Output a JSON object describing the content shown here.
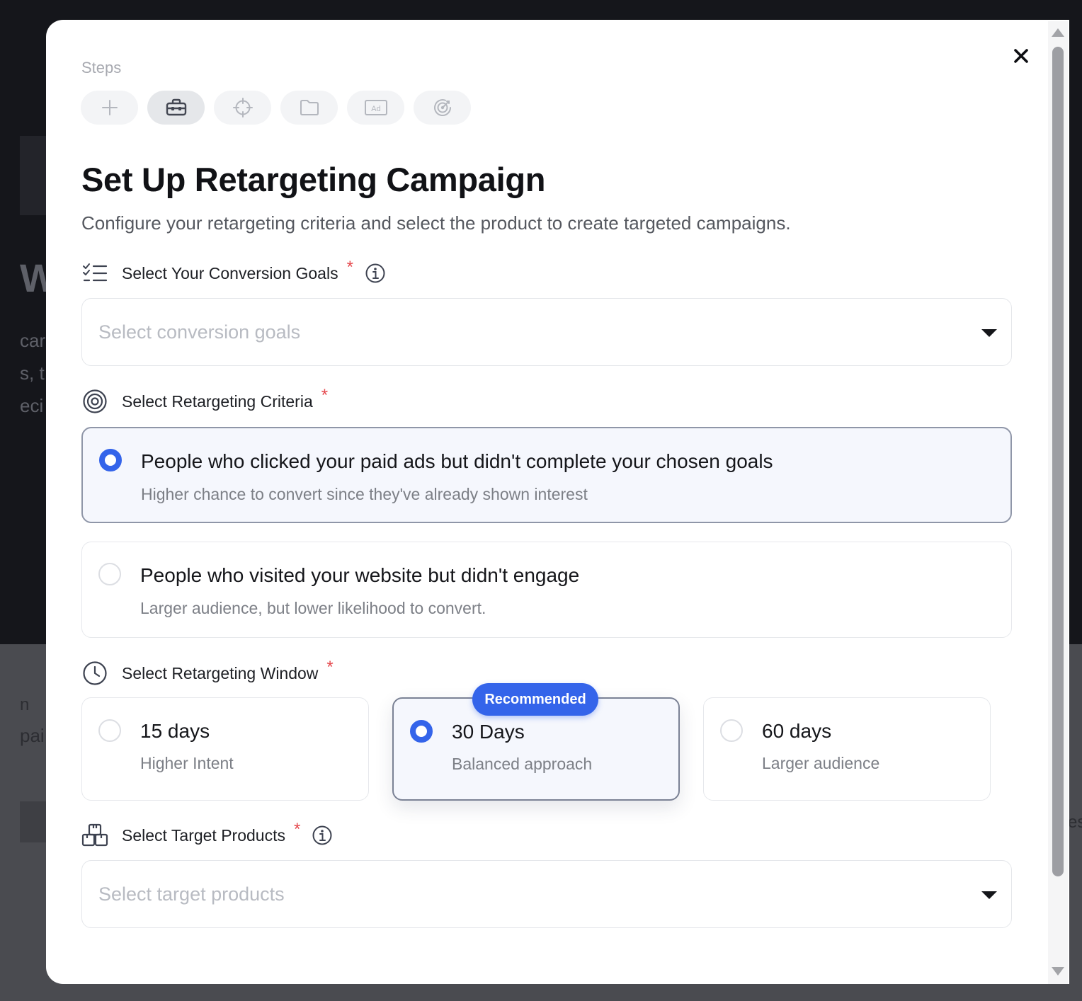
{
  "background": {
    "fragments": [
      "W",
      "car",
      "s, t",
      "eci",
      "n",
      "pai",
      "es"
    ]
  },
  "modal": {
    "steps_label": "Steps",
    "steps": [
      {
        "icon": "plus-icon",
        "active": false
      },
      {
        "icon": "toolbox-icon",
        "active": true
      },
      {
        "icon": "crosshair-icon",
        "active": false
      },
      {
        "icon": "folder-icon",
        "active": false
      },
      {
        "icon": "ad-icon",
        "active": false
      },
      {
        "icon": "target-refresh-icon",
        "active": false
      }
    ],
    "title": "Set Up Retargeting Campaign",
    "subtitle": "Configure your retargeting criteria and select the product to create targeted campaigns.",
    "conversion_goals": {
      "label": "Select Your Conversion Goals",
      "required_mark": "*",
      "placeholder": "Select conversion goals"
    },
    "criteria": {
      "label": "Select Retargeting Criteria",
      "required_mark": "*",
      "options": [
        {
          "title": "People who clicked your paid ads but didn't complete your chosen goals",
          "description": "Higher chance to convert since they've already shown interest",
          "selected": true
        },
        {
          "title": "People who visited your website but didn't engage",
          "description": "Larger audience, but lower likelihood to convert.",
          "selected": false
        }
      ]
    },
    "window": {
      "label": "Select Retargeting Window",
      "required_mark": "*",
      "badge": "Recommended",
      "options": [
        {
          "title": "15 days",
          "description": "Higher Intent",
          "selected": false
        },
        {
          "title": "30 Days",
          "description": "Balanced approach",
          "selected": true
        },
        {
          "title": "60 days",
          "description": "Larger audience",
          "selected": false
        }
      ]
    },
    "products": {
      "label": "Select Target Products",
      "required_mark": "*",
      "placeholder": "Select target products"
    }
  },
  "colors": {
    "accent": "#3464ea",
    "required": "#e5484d",
    "backdrop": "#15161b"
  }
}
